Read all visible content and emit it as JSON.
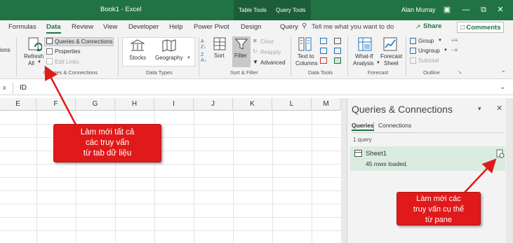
{
  "titlebar": {
    "doc_title": "Book1  -  Excel",
    "context_tabs": [
      "Table Tools",
      "Query Tools"
    ],
    "user": "Alan Murray"
  },
  "tabs": [
    {
      "label": "Formulas"
    },
    {
      "label": "Data",
      "active": true
    },
    {
      "label": "Review"
    },
    {
      "label": "View"
    },
    {
      "label": "Developer"
    },
    {
      "label": "Help"
    },
    {
      "label": "Power Pivot"
    },
    {
      "label": "Design"
    },
    {
      "label": "Query"
    }
  ],
  "tellme": "Tell me what you want to do",
  "share": "Share",
  "comments": "Comments",
  "ribbon": {
    "left_cut": "ions",
    "refresh_line1": "Refresh",
    "refresh_line2": "All",
    "queries_connections": "Queries & Connections",
    "properties": "Properties",
    "edit_links": "Edit Links",
    "group_queries": "Queries & Connections",
    "stocks": "Stocks",
    "geography": "Geography",
    "group_datatypes": "Data Types",
    "sort": "Sort",
    "filter": "Filter",
    "clear": "Clear",
    "reapply": "Reapply",
    "advanced": "Advanced",
    "group_sortfilter": "Sort & Filter",
    "text_to_columns_1": "Text to",
    "text_to_columns_2": "Columns",
    "group_datatools": "Data Tools",
    "whatif_1": "What-If",
    "whatif_2": "Analysis",
    "forecast_1": "Forecast",
    "forecast_2": "Sheet",
    "group_forecast": "Forecast",
    "group_btn": "Group",
    "ungroup_btn": "Ungroup",
    "subtotal": "Subtotal",
    "group_outline": "Outline"
  },
  "formula": {
    "fx_cut": "x",
    "value": "ID"
  },
  "columns": [
    "E",
    "F",
    "G",
    "H",
    "I",
    "J",
    "K",
    "L",
    "M"
  ],
  "pane": {
    "title": "Queries & Connections",
    "tab_queries": "Queries",
    "tab_connections": "Connections",
    "count": "1 query",
    "query_name": "Sheet1",
    "query_status": "45 rows loaded."
  },
  "callouts": {
    "c1": [
      "Làm mới tất cả",
      "các truy vấn",
      "từ tab dữ liệu"
    ],
    "c2": [
      "Làm mới các",
      "truy vấn cụ thể",
      "từ pane"
    ]
  },
  "colors": {
    "excel_green": "#217346",
    "callout_red": "#e01a1a",
    "query_card": "#d9ecdf"
  }
}
